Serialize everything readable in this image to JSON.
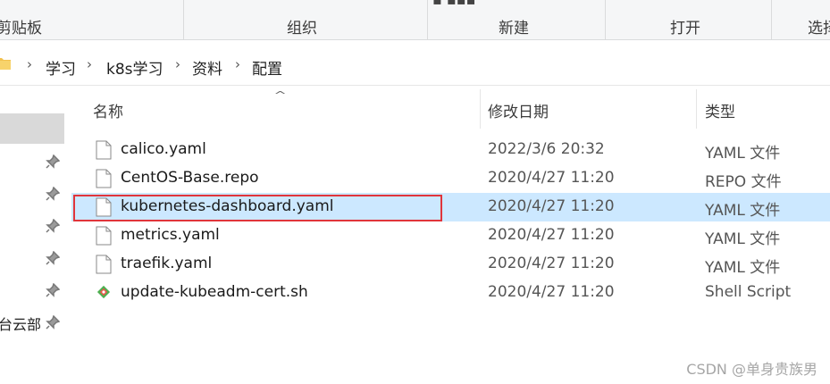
{
  "ribbon": {
    "groups": [
      {
        "label": "剪贴板"
      },
      {
        "label": "组织"
      },
      {
        "label": "新建"
      },
      {
        "label": "打开"
      },
      {
        "label": "选择"
      }
    ]
  },
  "address": {
    "crumbs": [
      "学习",
      "k8s学习",
      "资料",
      "配置"
    ]
  },
  "nav": {
    "partial_item": "台云部"
  },
  "columns": {
    "name": "名称",
    "modified": "修改日期",
    "type": "类型"
  },
  "files": [
    {
      "name": "calico.yaml",
      "modified": "2022/3/6 20:32",
      "type": "YAML 文件",
      "icon": "file-icon"
    },
    {
      "name": "CentOS-Base.repo",
      "modified": "2020/4/27 11:20",
      "type": "REPO 文件",
      "icon": "file-icon"
    },
    {
      "name": "kubernetes-dashboard.yaml",
      "modified": "2020/4/27 11:20",
      "type": "YAML 文件",
      "icon": "file-icon",
      "selected": true
    },
    {
      "name": "metrics.yaml",
      "modified": "2020/4/27 11:20",
      "type": "YAML 文件",
      "icon": "file-icon"
    },
    {
      "name": "traefik.yaml",
      "modified": "2020/4/27 11:20",
      "type": "YAML 文件",
      "icon": "file-icon"
    },
    {
      "name": "update-kubeadm-cert.sh",
      "modified": "2020/4/27 11:20",
      "type": "Shell Script",
      "icon": "git-shell-icon"
    }
  ],
  "watermark": "CSDN @单身贵族男",
  "colors": {
    "selection": "#cce8ff",
    "highlight_border": "#e0353b"
  }
}
